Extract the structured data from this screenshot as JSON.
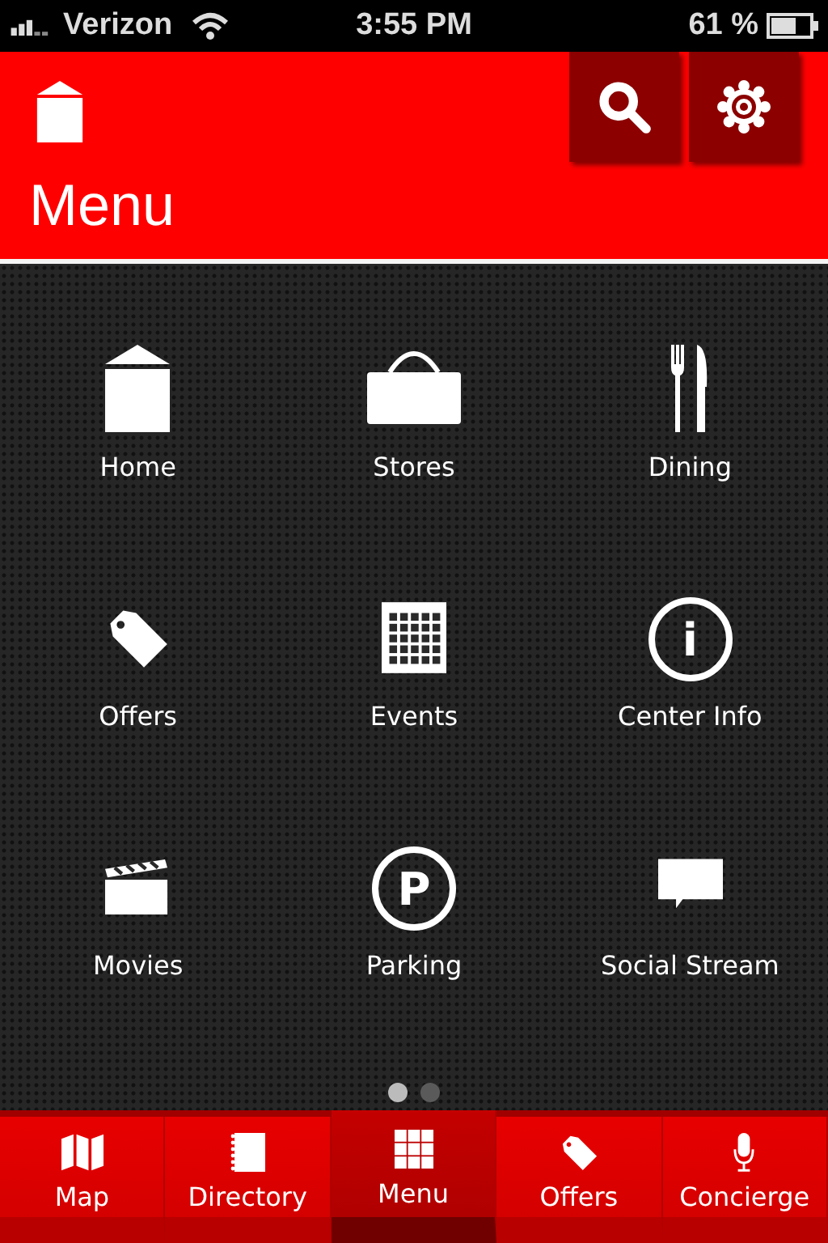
{
  "status_bar": {
    "carrier": "Verizon",
    "time": "3:55 PM",
    "battery": "61 %"
  },
  "header": {
    "title": "Menu"
  },
  "grid": [
    {
      "label": "Home",
      "kind": "house"
    },
    {
      "label": "Stores",
      "kind": "bag"
    },
    {
      "label": "Dining",
      "kind": "cutlery"
    },
    {
      "label": "Offers",
      "kind": "tag"
    },
    {
      "label": "Events",
      "kind": "calendar"
    },
    {
      "label": "Center Info",
      "kind": "circle",
      "glyph": "i"
    },
    {
      "label": "Movies",
      "kind": "clapper"
    },
    {
      "label": "Parking",
      "kind": "circle",
      "glyph": "P"
    },
    {
      "label": "Social Stream",
      "kind": "bubble"
    }
  ],
  "pages": [
    {
      "selected": true
    },
    {
      "selected": false
    }
  ],
  "tabs": [
    {
      "label": "Map",
      "kind": "map",
      "selected": false
    },
    {
      "label": "Directory",
      "kind": "book",
      "selected": false
    },
    {
      "label": "Menu",
      "kind": "grid",
      "selected": true
    },
    {
      "label": "Offers",
      "kind": "tag",
      "selected": false
    },
    {
      "label": "Concierge",
      "kind": "mic",
      "selected": false
    }
  ]
}
